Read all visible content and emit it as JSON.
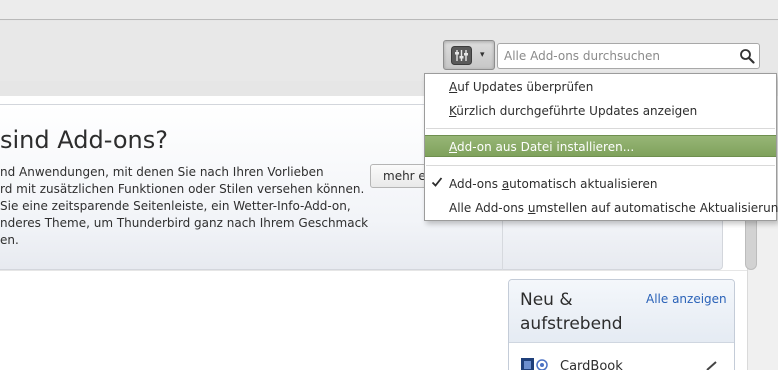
{
  "toolbar": {
    "tools_button_icon": "addon-tools-gear-icon",
    "tools_caret": "▾",
    "search_placeholder": "Alle Add-ons durchsuchen",
    "search_icon": "search-icon"
  },
  "hero": {
    "title": "sind Add-ons?",
    "lines": [
      "nd Anwendungen, mit denen Sie nach Ihren Vorlieben",
      "rd mit zusätzlichen Funktionen oder Stilen versehen können.",
      " Sie eine zeitsparende Seitenleiste, ein Wetter-Info-Add-on,",
      "nderes Theme, um Thunderbird ganz nach Ihrem Geschmack",
      "en."
    ],
    "more_button": "mehr erfahren"
  },
  "card": {
    "title": "Neu & aufstrebend",
    "link": "Alle anzeigen",
    "item_label": "CardBook"
  },
  "menu": {
    "items": [
      {
        "pre": "",
        "acc": "A",
        "post": "uf Updates überprüfen"
      },
      {
        "pre": "",
        "acc": "K",
        "post": "ürzlich durchgeführte Updates anzeigen"
      },
      {
        "pre": "",
        "acc": "A",
        "post": "dd-on aus Datei installieren..."
      },
      {
        "pre": "Add-ons ",
        "acc": "a",
        "post": "utomatisch aktualisieren"
      },
      {
        "pre": "Alle Add-ons ",
        "acc": "u",
        "post": "mstellen auf automatische Aktualisierung"
      }
    ],
    "highlighted_index": 2,
    "checked_index": 3
  },
  "colors": {
    "highlight": "#8aac68",
    "link": "#2a62b8"
  }
}
